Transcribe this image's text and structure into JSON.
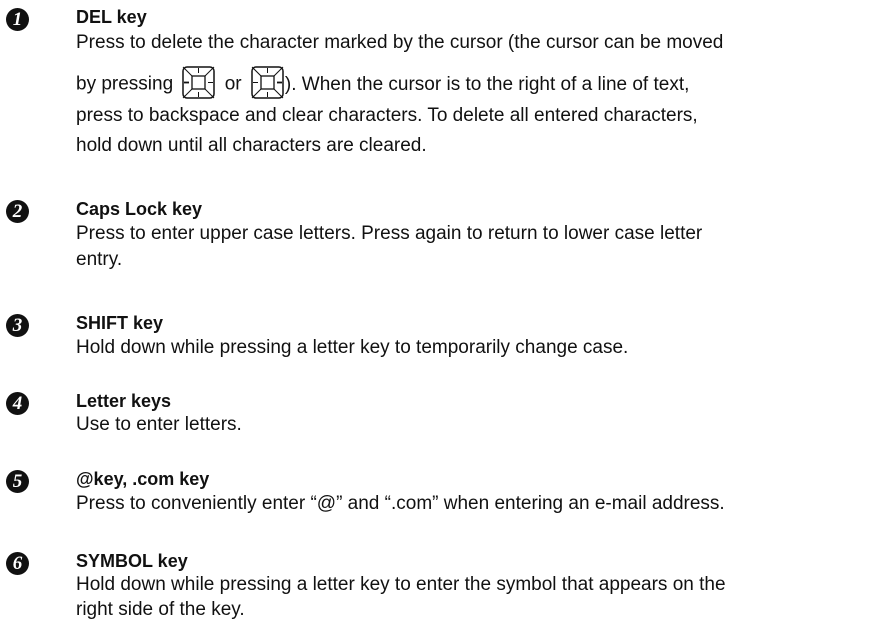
{
  "entries": [
    {
      "number": "1",
      "title": "DEL key",
      "line1": "Press to delete the character marked by the cursor (the cursor can be moved",
      "line2_before": "by pressing",
      "line2_mid": "or",
      "line2_after": "). When the cursor is to the right of a line of text,",
      "line3": "press to backspace and clear characters. To delete all entered characters,",
      "line4": "hold down until all characters are cleared.",
      "icons": [
        "cursor-left-key-icon",
        "cursor-right-key-icon"
      ]
    },
    {
      "number": "2",
      "title": "Caps Lock key",
      "line1": "Press to enter upper case letters. Press again to return to lower case letter",
      "line2": "entry."
    },
    {
      "number": "3",
      "title": "SHIFT key",
      "line1": "Hold down while pressing a letter key to temporarily change case."
    },
    {
      "number": "4",
      "title": "Letter keys",
      "line1": "Use to enter letters."
    },
    {
      "number": "5",
      "title": "@key, .com key",
      "line1": "Press to conveniently enter “@” and “.com” when entering an e-mail address."
    },
    {
      "number": "6",
      "title": "SYMBOL key",
      "line1": "Hold down while pressing a letter key to enter the symbol that appears on the",
      "line2": "right side of the key."
    }
  ]
}
